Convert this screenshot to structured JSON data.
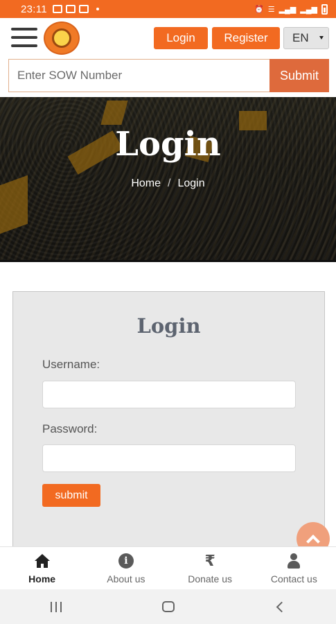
{
  "status_bar": {
    "time": "23:11"
  },
  "header": {
    "login_label": "Login",
    "register_label": "Register",
    "language": "EN"
  },
  "sow_search": {
    "placeholder": "Enter SOW Number",
    "submit_label": "Submit"
  },
  "hero": {
    "title": "Login",
    "breadcrumb": {
      "home": "Home",
      "separator": "/",
      "current": "Login"
    }
  },
  "login_form": {
    "title": "Login",
    "username_label": "Username:",
    "username_value": "",
    "password_label": "Password:",
    "password_value": "",
    "submit_label": "submit"
  },
  "bottom_nav": {
    "items": [
      {
        "label": "Home",
        "icon": "home-icon",
        "active": true
      },
      {
        "label": "About us",
        "icon": "info-icon",
        "active": false
      },
      {
        "label": "Donate us",
        "icon": "rupee-icon",
        "active": false
      },
      {
        "label": "Contact us",
        "icon": "user-icon",
        "active": false
      }
    ]
  },
  "colors": {
    "brand_orange": "#f26a21",
    "sow_submit": "#de6a3c",
    "card_bg": "#e8e8e8",
    "scroll_top": "#f0a07c"
  }
}
